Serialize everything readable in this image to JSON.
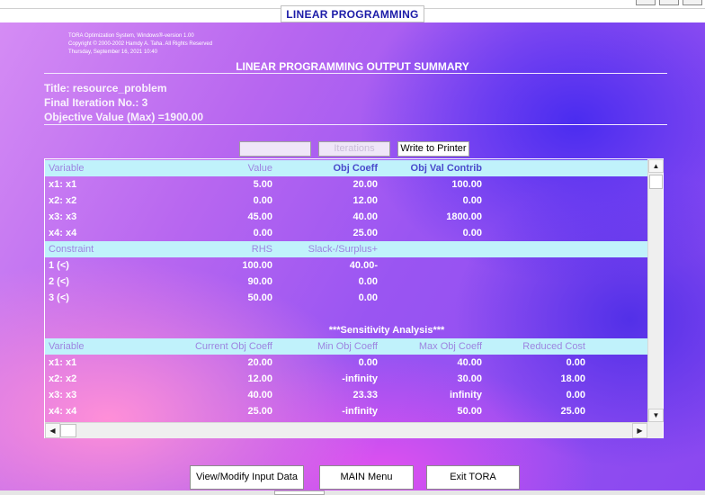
{
  "window": {
    "heading": "LINEAR PROGRAMMING"
  },
  "header": {
    "lines": [
      "TORA Optimization System, Windows®-version 1.00",
      "Copyright © 2000-2002 Hamdy A. Taha. All Rights Reserved",
      "Thursday, September 16, 2021 10:40"
    ]
  },
  "summary_title": "LINEAR PROGRAMMING OUTPUT SUMMARY",
  "info": {
    "title": "Title: resource_problem",
    "final_iteration": "Final Iteration No.: 3",
    "objective": "Objective Value (Max) =1900.00"
  },
  "toolbar": {
    "btn1_label": "",
    "btn2_label": "Iterations",
    "write_label": "Write to Printer"
  },
  "variables_table": {
    "headers": [
      "Variable",
      "Value",
      "Obj Coeff",
      "Obj Val Contrib"
    ],
    "rows": [
      [
        "x1:  x1",
        "5.00",
        "20.00",
        "100.00"
      ],
      [
        "x2:  x2",
        "0.00",
        "12.00",
        "0.00"
      ],
      [
        "x3:  x3",
        "45.00",
        "40.00",
        "1800.00"
      ],
      [
        "x4:  x4",
        "0.00",
        "25.00",
        "0.00"
      ]
    ]
  },
  "constraints_table": {
    "headers": [
      "Constraint",
      "RHS",
      "Slack-/Surplus+"
    ],
    "rows": [
      [
        "1 (<)",
        "100.00",
        "40.00-"
      ],
      [
        "2 (<)",
        "90.00",
        "0.00"
      ],
      [
        "3 (<)",
        "50.00",
        "0.00"
      ]
    ]
  },
  "sensitivity_title": "***Sensitivity Analysis***",
  "sensitivity_table": {
    "headers": [
      "Variable",
      "Current Obj Coeff",
      "Min Obj Coeff",
      "Max Obj Coeff",
      "Reduced Cost"
    ],
    "rows": [
      [
        "x1:  x1",
        "20.00",
        "0.00",
        "40.00",
        "0.00"
      ],
      [
        "x2:  x2",
        "12.00",
        "-infinity",
        "30.00",
        "18.00"
      ],
      [
        "x3:  x3",
        "40.00",
        "23.33",
        "infinity",
        "0.00"
      ],
      [
        "x4:  x4",
        "25.00",
        "-infinity",
        "50.00",
        "25.00"
      ]
    ]
  },
  "buttons": {
    "view_modify": "View/Modify Input Data",
    "main_menu": "MAIN Menu",
    "exit": "Exit TORA"
  },
  "icons": {
    "scroll_up": "scroll-up-arrow-icon",
    "scroll_down": "scroll-down-arrow-icon",
    "scroll_left": "scroll-left-arrow-icon",
    "scroll_right": "scroll-right-arrow-icon"
  },
  "colors": {
    "header_row_bg": "#c0f2fb",
    "heading_text": "#1c1ca8",
    "background_purple": "#8a48f0",
    "background_pink": "#ff8fd8"
  }
}
